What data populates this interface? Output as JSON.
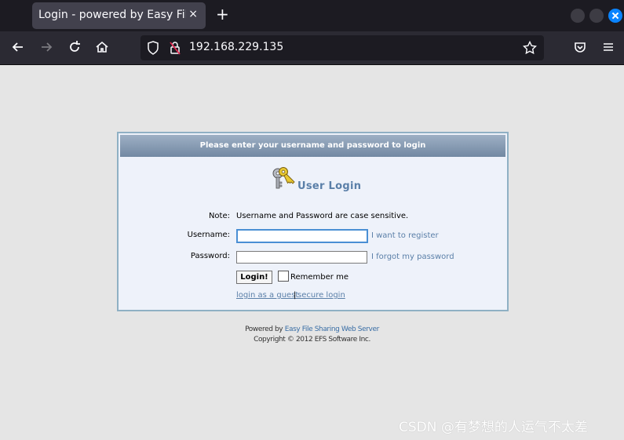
{
  "browser": {
    "tab_title": "Login - powered by Easy File",
    "tab_close": "×",
    "new_tab": "+",
    "url": "192.168.229.135"
  },
  "login": {
    "header": "Please enter your username and password to login",
    "title": "User Login",
    "note_label": "Note:",
    "note_text": "Username and Password are case sensitive.",
    "username_label": "Username:",
    "username_value": "",
    "register_link": "I want to register",
    "password_label": "Password:",
    "password_value": "",
    "forgot_link": "I forgot my password",
    "login_button": "Login!",
    "remember_label": "Remember me",
    "remember_checked": false,
    "guest_link": "login as a guest",
    "separator": "|",
    "secure_link": "secure login"
  },
  "footer": {
    "powered_prefix": "Powered by",
    "powered_link": "Easy File Sharing Web Server",
    "copyright": "Copyright © 2012 EFS Software Inc."
  },
  "watermark": "CSDN @有梦想的人运气不太差",
  "colors": {
    "accent": "#5a7fa8",
    "header_start": "#9eb0c5",
    "header_end": "#7288a2"
  }
}
